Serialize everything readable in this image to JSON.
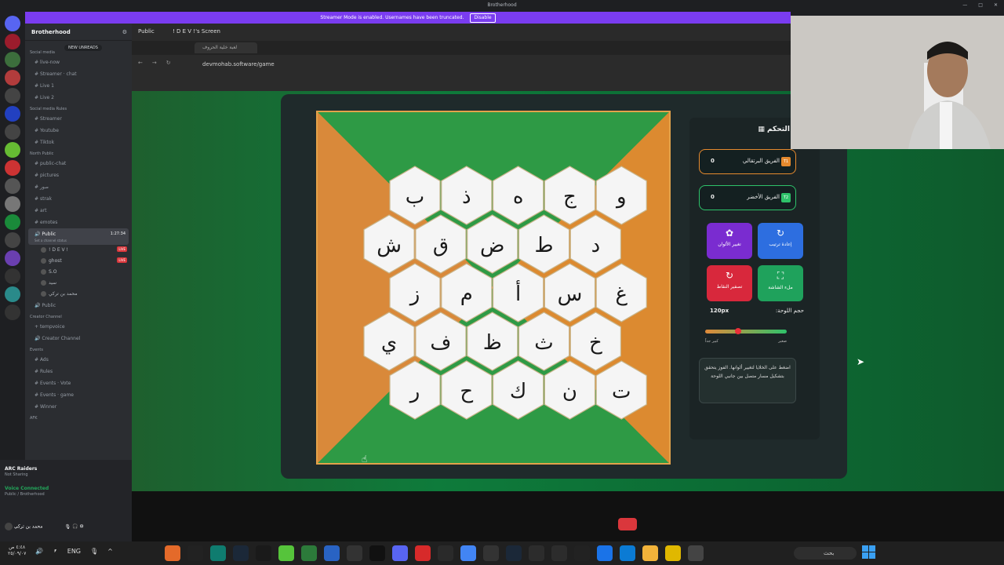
{
  "titlebar": {
    "title": "Brotherhood"
  },
  "banner": {
    "text": "Streamer Mode is enabled. Usernames have been truncated.",
    "disable_label": "Disable"
  },
  "sidebar": {
    "server_name": "Brotherhood",
    "new_unreads": "NEW UNREADS",
    "categories": [
      {
        "name": "Social media",
        "channels": [
          "live-now",
          "Streamer · chat",
          "Live 1",
          "Live 2"
        ]
      },
      {
        "name": "Social media Rules",
        "channels": [
          "Streamer",
          "Youtube",
          "Tiktok"
        ]
      },
      {
        "name": "North Public",
        "channels": [
          "public-chat",
          "pictures",
          "صور",
          "strak",
          "art",
          "emotes"
        ]
      }
    ],
    "voice_channel": {
      "name": "Public",
      "timer": "1:27:34",
      "status": "Set a channel status"
    },
    "voice_users": [
      "! D E V !",
      "ghost",
      "S.O",
      "سيد",
      "محمد بن تركي"
    ],
    "live_label": "LIVE",
    "public2": "Public",
    "creator_cat": "Creator Channel",
    "creator_channels": [
      "tempvoice",
      "Creator Channel"
    ],
    "events_cat": "Events",
    "events_channels": [
      "Ads",
      "Rules",
      "Events · Vote",
      "Events · game",
      "Winner"
    ],
    "afk_cat": "AFK",
    "afk_channel": "AFK"
  },
  "voice_panel": {
    "activity_title": "ARC Raiders",
    "activity_sub": "Not Sharing",
    "connected": "Voice Connected",
    "connected_sub": "Public / Brotherhood",
    "user": "محمد بن تركي"
  },
  "stream": {
    "tab_public": "Public",
    "tab_screen": "! D E V !'s Screen",
    "browser_tab_title": "لعبة خلية الحروف",
    "url": "devmohab.software/game"
  },
  "board": {
    "rows": [
      [
        "ب",
        "ذ",
        "ه",
        "ج",
        "و"
      ],
      [
        "ش",
        "ق",
        "ض",
        "ط",
        "د"
      ],
      [
        "ز",
        "م",
        "أ",
        "س",
        "غ"
      ],
      [
        "ي",
        "ف",
        "ظ",
        "ث",
        "خ"
      ],
      [
        "ر",
        "ح",
        "ك",
        "ن",
        "ت"
      ]
    ]
  },
  "panel": {
    "title": "لوحة التحكم",
    "orange_team": {
      "name": "الفريق البرتقالي",
      "score": "0",
      "badge": "T1"
    },
    "green_team": {
      "name": "الفريق الأخضر",
      "score": "0",
      "badge": "T2"
    },
    "btn_colors": "تغيير الألوان",
    "btn_reorder": "إعادة ترتيب",
    "btn_fix": "تصفير النقاط",
    "btn_fullscreen": "ملء الشاشة",
    "size_label": "حجم اللوحة:",
    "size_value": "120px",
    "slider_left": "كبير جداً",
    "slider_right": "صغير",
    "hint": "اضغط على الخلايا لتغيير ألوانها. الفوز يتحقق بتشكيل مسار متصل بين جانبي اللوحة"
  },
  "taskbar": {
    "time": "٤:٤٨ ص",
    "date": "٢٥/٠٩/٠٧",
    "lang": "ENG",
    "search_placeholder": "بحث"
  }
}
